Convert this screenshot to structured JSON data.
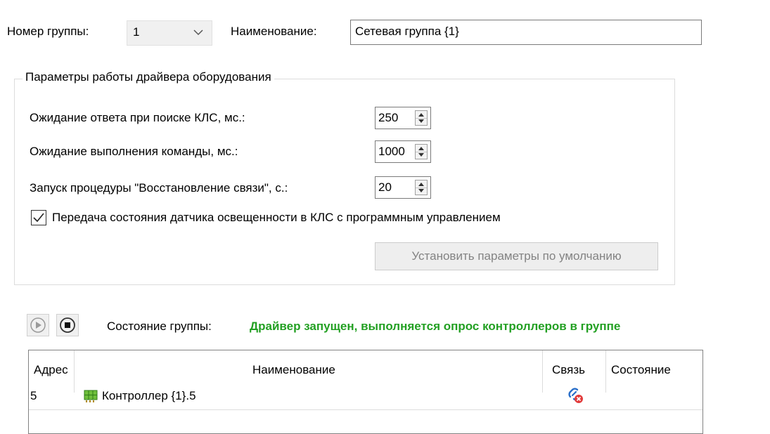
{
  "group_number": {
    "label": "Номер группы:",
    "value": "1"
  },
  "name": {
    "label": "Наименование:",
    "value": "Сетевая группа {1}"
  },
  "driver_params": {
    "title": "Параметры работы драйвера оборудования",
    "fields": [
      {
        "label": "Ожидание ответа при поиске КЛС, мс.:",
        "value": "250"
      },
      {
        "label": "Ожидание выполнения команды, мс.:",
        "value": "1000"
      },
      {
        "label": "Запуск процедуры \"Восстановление связи\", с.:",
        "value": "20"
      }
    ],
    "checkbox": {
      "label": "Передача состояния датчика освещенности в КЛС с программным управлением",
      "checked": true
    },
    "default_button": "Установить параметры по умолчанию"
  },
  "controls": {
    "play_icon": "play-icon",
    "stop_icon": "stop-icon"
  },
  "group_state": {
    "label": "Состояние группы:",
    "value": "Драйвер запущен, выполняется опрос контроллеров в группе",
    "color": "#23a023"
  },
  "table": {
    "headers": [
      "Адрес",
      "Наименование",
      "Связь",
      "Состояние"
    ],
    "rows": [
      {
        "address": "5",
        "icon": "controller-icon",
        "name": "Контроллер {1}.5",
        "link_icon": "link-error-icon",
        "state": ""
      }
    ]
  }
}
